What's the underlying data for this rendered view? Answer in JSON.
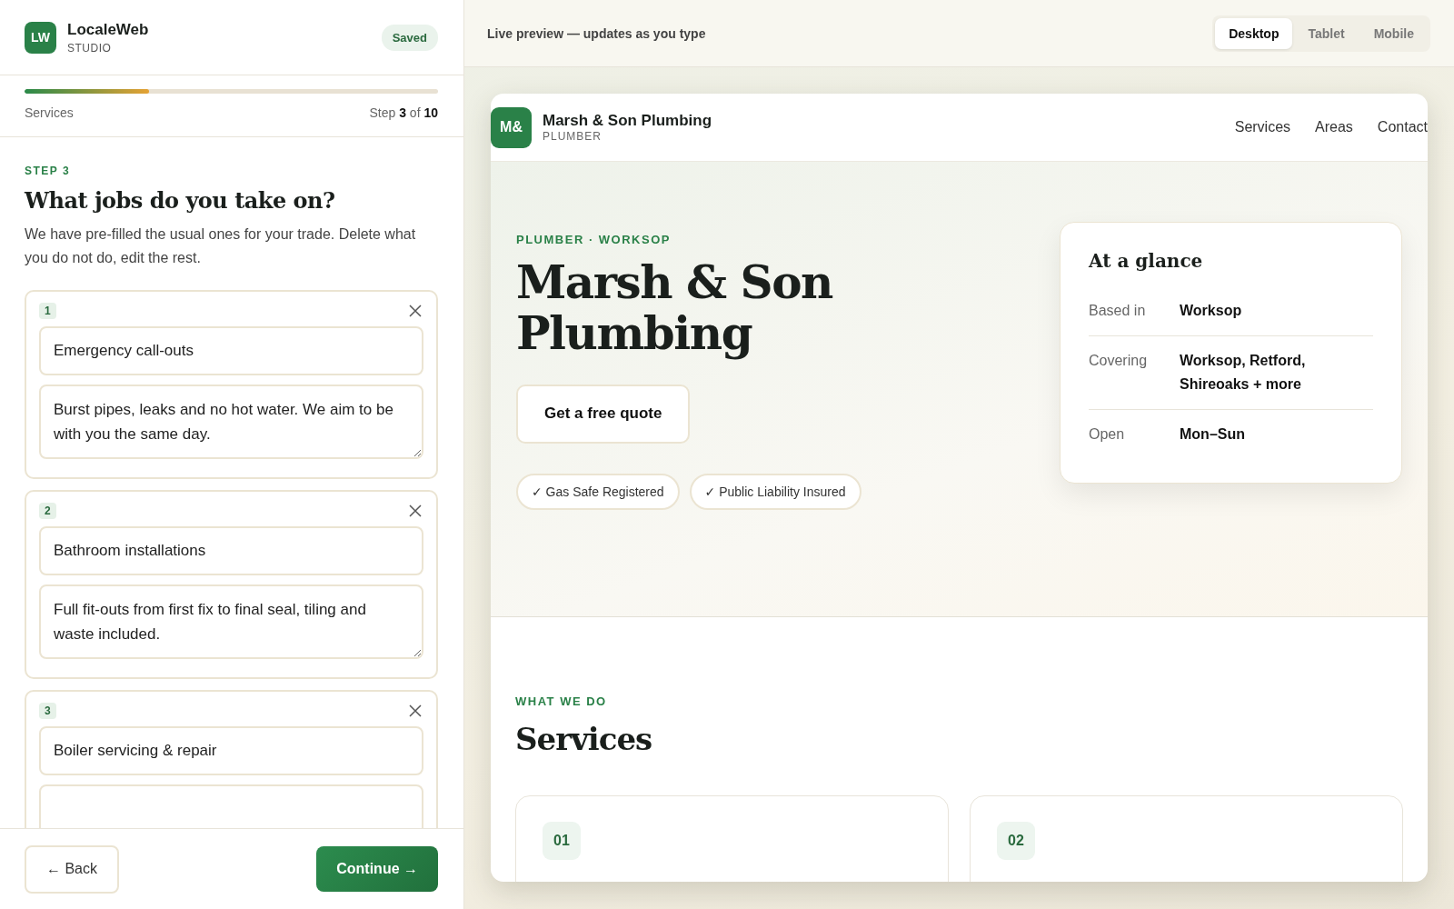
{
  "brand": {
    "logo": "LW",
    "name": "LocaleWeb",
    "sub": "STUDIO"
  },
  "save_status": "Saved",
  "progress": {
    "label": "Services",
    "level": 0.3,
    "step_text": "Step **3** of **10**"
  },
  "step": {
    "eyebrow": "STEP 3",
    "title": "What jobs do you take on?",
    "description": "We have pre-filled the usual ones for your trade. Delete what you do not do, edit the rest."
  },
  "services": [
    {
      "number": "1",
      "title": "Emergency call-outs",
      "description": "Burst pipes, leaks and no hot water. We aim to be with you the same day."
    },
    {
      "number": "2",
      "title": "Bathroom installations",
      "description": "Full fit-outs from first fix to final seal, tiling and waste included."
    },
    {
      "number": "3",
      "title": "Boiler servicing & repair"
    }
  ],
  "footer": {
    "back": "← Back",
    "continue": "Continue →"
  },
  "preview": {
    "caption": "Live preview — updates as you type",
    "devices": [
      {
        "label": "Desktop",
        "selected": true
      },
      {
        "label": "Tablet",
        "selected": false
      },
      {
        "label": "Mobile",
        "selected": false
      }
    ],
    "site": {
      "logo": "M&",
      "name": "Marsh & Son Plumbing",
      "trade": "PLUMBER",
      "nav": [
        "Services",
        "Areas",
        "Contact"
      ],
      "hero_eyebrow": "PLUMBER · WORKSOP",
      "hero_title": "Marsh & Son Plumbing",
      "cta": "Get a free quote",
      "badges": [
        "✓ Gas Safe Registered",
        "✓ Public Liability Insured"
      ],
      "glance": {
        "title": "At a glance",
        "rows": [
          {
            "label": "Based in",
            "value": "Worksop"
          },
          {
            "label": "Covering",
            "value": "Worksop, Retford, Shireoaks + more"
          },
          {
            "label": "Open",
            "value": "Mon–Sun"
          }
        ]
      },
      "section_eyebrow": "WHAT WE DO",
      "section_title": "Services",
      "service_cards": [
        {
          "number": "01"
        },
        {
          "number": "02"
        }
      ]
    }
  }
}
